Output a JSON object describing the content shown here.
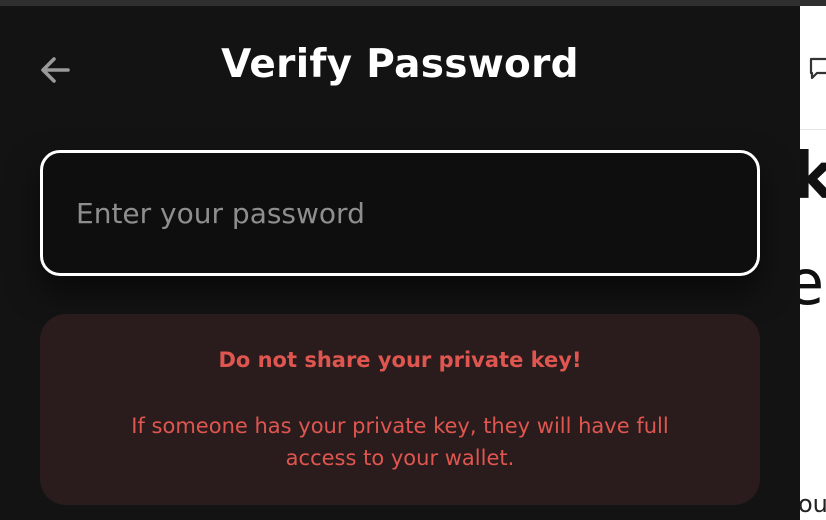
{
  "header": {
    "title": "Verify Password",
    "back_icon": "arrow-left-icon"
  },
  "password_field": {
    "value": "",
    "placeholder": "Enter your password"
  },
  "warning": {
    "title": "Do not share your private key!",
    "body": "If someone has your private key, they will have full access to your wallet."
  },
  "background_page": {
    "fragment_1": "k",
    "fragment_2": "e",
    "fragment_3": "ou",
    "chat_icon": "chat-bubble-icon"
  },
  "colors": {
    "panel_bg": "#131313",
    "warning_bg": "#2a1c1c",
    "warning_text": "#df5650",
    "text_primary": "#ffffff",
    "placeholder": "#8e8e8e"
  }
}
